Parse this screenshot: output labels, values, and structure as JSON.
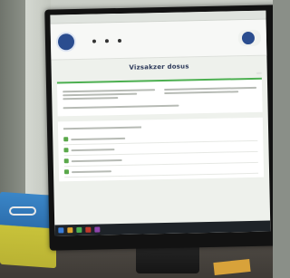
{
  "app": {
    "logo_text": [
      "",
      "",
      ""
    ],
    "nav": [
      "",
      "",
      ""
    ],
    "user_initial": "",
    "user_label": ""
  },
  "page": {
    "title": "Vizsakzer dosus",
    "back_label": "",
    "print_label": ""
  },
  "colors": {
    "brand": "#2b4d8f",
    "accent": "#4caf50"
  },
  "taskbar": {
    "clock": ""
  }
}
